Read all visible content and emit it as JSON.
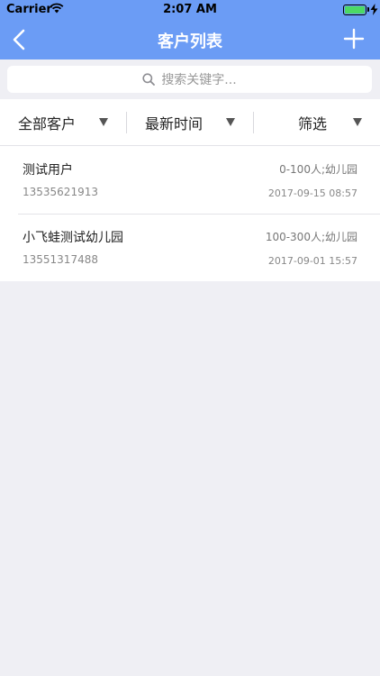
{
  "status_bar": {
    "carrier": "Carrier",
    "time": "2:07 AM"
  },
  "navbar": {
    "title": "客户列表",
    "back_icon": "chevron-left-icon",
    "add_icon": "plus-icon"
  },
  "search": {
    "placeholder": "搜索关键字..."
  },
  "filters": [
    {
      "label": "全部客户"
    },
    {
      "label": "最新时间"
    },
    {
      "label": "筛选"
    }
  ],
  "customers": [
    {
      "name": "测试用户",
      "phone": "13535621913",
      "info": "0-100人;幼儿园",
      "date": "2017-09-15 08:57"
    },
    {
      "name": "小飞蛙测试幼儿园",
      "phone": "13551317488",
      "info": "100-300人;幼儿园",
      "date": "2017-09-01 15:57"
    }
  ],
  "colors": {
    "header": "#6b9cf5",
    "background": "#efeff4",
    "battery": "#4cd964"
  }
}
